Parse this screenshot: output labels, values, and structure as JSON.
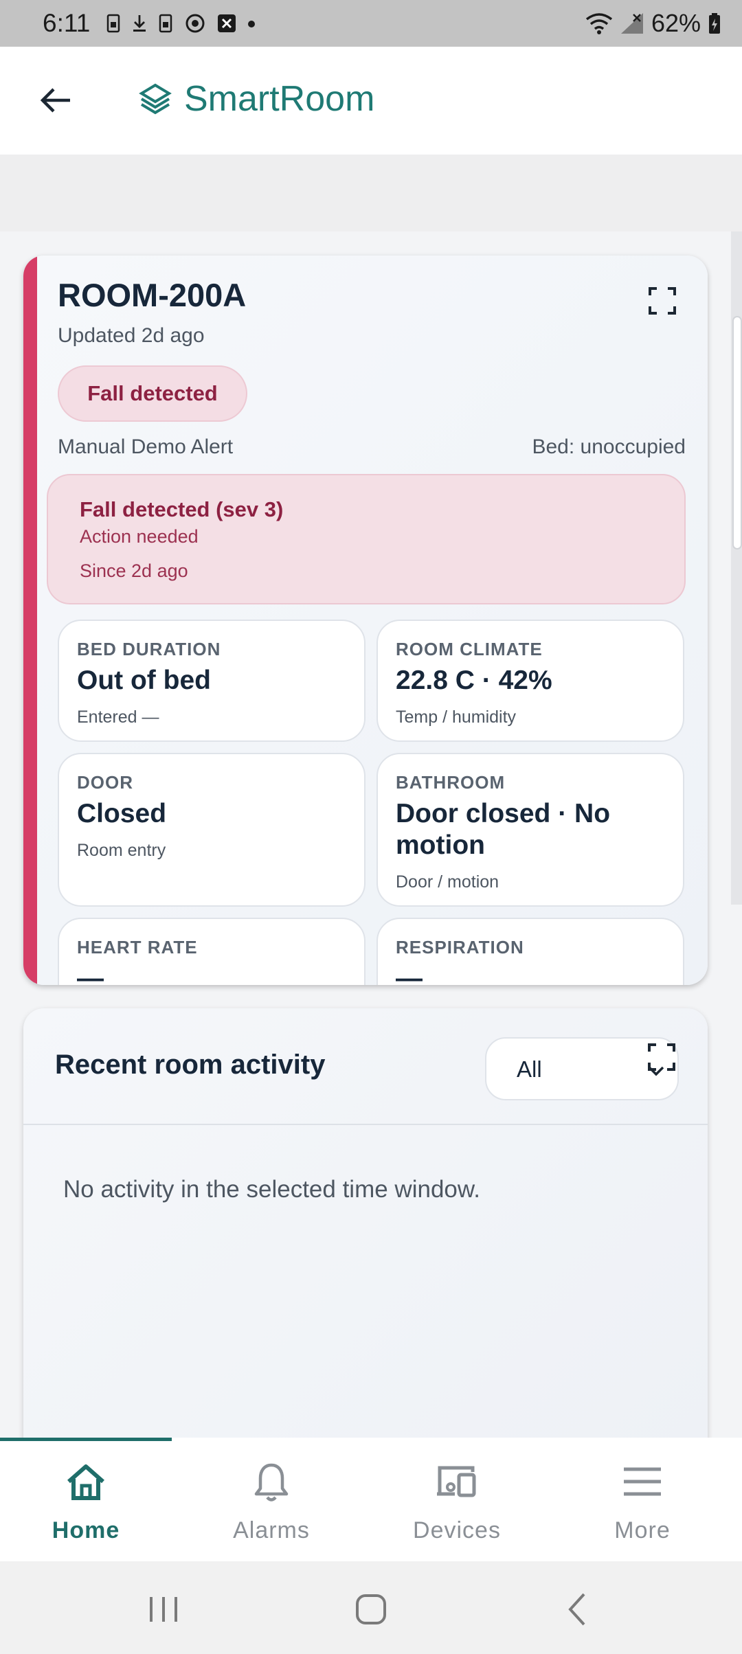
{
  "status_bar": {
    "time": "6:11",
    "battery": "62%"
  },
  "app_bar": {
    "brand": "SmartRoom",
    "brand_color": "#1f7a74"
  },
  "room_card": {
    "room_name": "ROOM-200A",
    "updated": "Updated 2d ago",
    "status_pill": "Fall detected",
    "alert_name": "Manual Demo Alert",
    "bed_status": "Bed: unoccupied",
    "accent_color": "#d63d66",
    "alert": {
      "title": "Fall detected (sev 3)",
      "action": "Action needed",
      "since": "Since 2d ago"
    },
    "metrics": [
      {
        "label": "BED DURATION",
        "value": "Out of bed",
        "sub": "Entered —"
      },
      {
        "label": "ROOM CLIMATE",
        "value": "22.8 C · 42%",
        "sub": "Temp / humidity"
      },
      {
        "label": "DOOR",
        "value": "Closed",
        "sub": "Room entry"
      },
      {
        "label": "BATHROOM",
        "value": "Door closed · No motion",
        "sub": "Door / motion"
      },
      {
        "label": "HEART RATE",
        "value": "—"
      },
      {
        "label": "RESPIRATION",
        "value": "—"
      }
    ]
  },
  "activity": {
    "title": "Recent room activity",
    "filter_value": "All",
    "empty_message": "No activity in the selected time window."
  },
  "bottom_nav": {
    "items": [
      {
        "label": "Home",
        "icon": "home-icon",
        "active": true
      },
      {
        "label": "Alarms",
        "icon": "bell-icon",
        "active": false
      },
      {
        "label": "Devices",
        "icon": "devices-icon",
        "active": false
      },
      {
        "label": "More",
        "icon": "menu-icon",
        "active": false
      }
    ],
    "active_color": "#1f6e6a"
  }
}
